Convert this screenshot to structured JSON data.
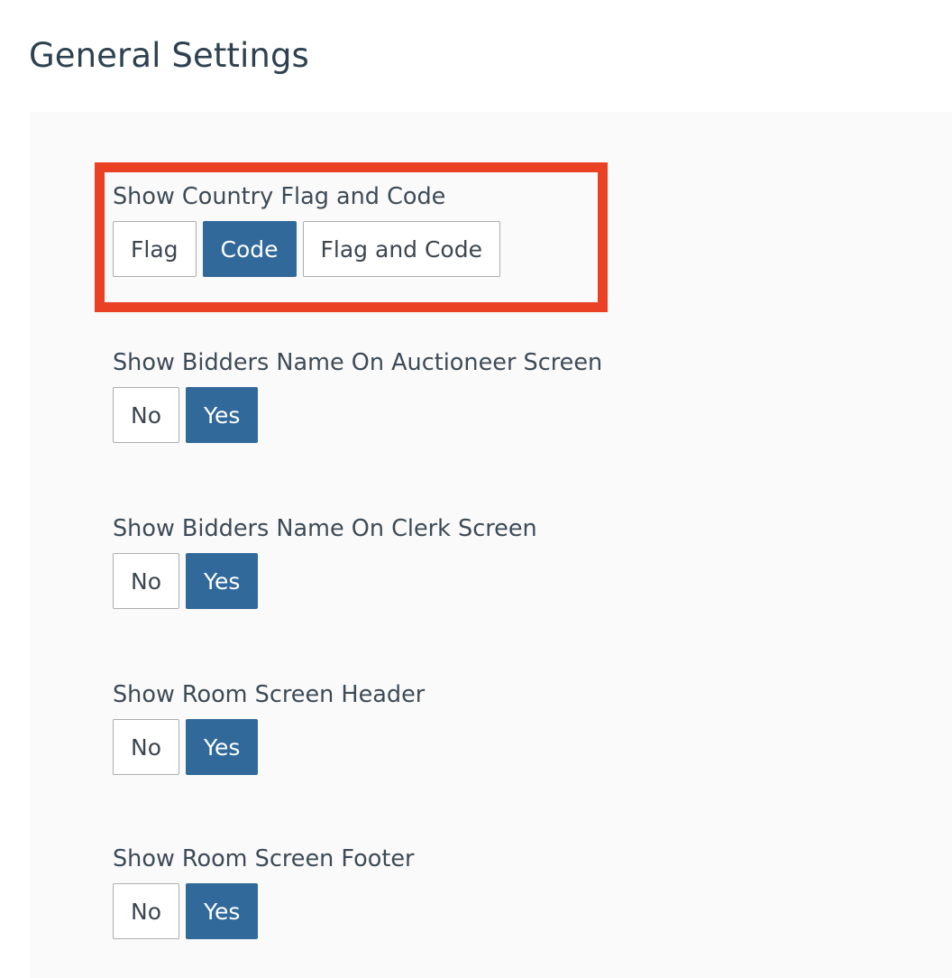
{
  "page": {
    "title": "General Settings",
    "background_color": "#ffffff",
    "panel_background_color": "#fafafa"
  },
  "colors": {
    "title_text": "#2e4150",
    "label_text": "#3d4b57",
    "active_button_bg": "#31699b",
    "active_button_text": "#ffffff",
    "inactive_button_bg": "#ffffff",
    "inactive_button_border": "#adadad",
    "inactive_button_text": "#3b4650",
    "highlight_border": "#ea4124"
  },
  "annotation": {
    "name": "red-highlight-box",
    "target": "Show Country Flag and Code",
    "border_color": "#ea4124",
    "border_width_px": 11
  },
  "settings": [
    {
      "id": "show-country-flag-and-code",
      "label": "Show Country Flag and Code",
      "highlighted": true,
      "options": [
        {
          "label": "Flag",
          "selected": false
        },
        {
          "label": "Code",
          "selected": true
        },
        {
          "label": "Flag and Code",
          "selected": false
        }
      ],
      "selected_value": "Code"
    },
    {
      "id": "show-bidders-name-on-auctioneer-screen",
      "label": "Show Bidders Name On Auctioneer Screen",
      "highlighted": false,
      "options": [
        {
          "label": "No",
          "selected": false
        },
        {
          "label": "Yes",
          "selected": true
        }
      ],
      "selected_value": "Yes"
    },
    {
      "id": "show-bidders-name-on-clerk-screen",
      "label": "Show Bidders Name On Clerk Screen",
      "highlighted": false,
      "options": [
        {
          "label": "No",
          "selected": false
        },
        {
          "label": "Yes",
          "selected": true
        }
      ],
      "selected_value": "Yes"
    },
    {
      "id": "show-room-screen-header",
      "label": "Show Room Screen Header",
      "highlighted": false,
      "options": [
        {
          "label": "No",
          "selected": false
        },
        {
          "label": "Yes",
          "selected": true
        }
      ],
      "selected_value": "Yes"
    },
    {
      "id": "show-room-screen-footer",
      "label": "Show Room Screen Footer",
      "highlighted": false,
      "options": [
        {
          "label": "No",
          "selected": false
        },
        {
          "label": "Yes",
          "selected": true
        }
      ],
      "selected_value": "Yes"
    }
  ]
}
